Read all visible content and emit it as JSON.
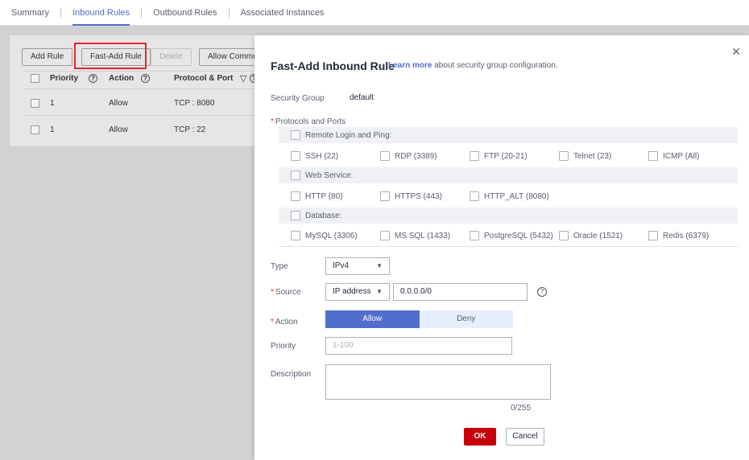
{
  "tabs": [
    {
      "label": "Summary"
    },
    {
      "label": "Inbound Rules"
    },
    {
      "label": "Outbound Rules"
    },
    {
      "label": "Associated Instances"
    }
  ],
  "background": {
    "buttons": {
      "add_rule": "Add Rule",
      "fast_add_rule": "Fast-Add Rule",
      "delete": "Delete",
      "allow_common": "Allow Commor"
    },
    "table_headers": {
      "priority": "Priority",
      "action": "Action",
      "protocol_port": "Protocol & Port"
    },
    "rows": [
      {
        "priority": "1",
        "action": "Allow",
        "protocol_port": "TCP : 8080"
      },
      {
        "priority": "1",
        "action": "Allow",
        "protocol_port": "TCP : 22"
      }
    ]
  },
  "drawer": {
    "title": "Fast-Add Inbound Rule",
    "learn_link": "Learn more",
    "learn_suffix": "about security group configuration.",
    "security_group_label": "Security Group",
    "security_group_value": "default",
    "protocols_label": "Protocols and Ports",
    "groups": [
      {
        "name": "Remote Login and Ping:",
        "options": [
          "SSH (22)",
          "RDP (3389)",
          "FTP (20-21)",
          "Telnet (23)",
          "ICMP (All)"
        ]
      },
      {
        "name": "Web Service:",
        "options": [
          "HTTP (80)",
          "HTTPS (443)",
          "HTTP_ALT (8080)"
        ]
      },
      {
        "name": "Database:",
        "options": [
          "MySQL (3306)",
          "MS SQL (1433)",
          "PostgreSQL (5432)",
          "Oracle (1521)",
          "Redis (6379)"
        ]
      }
    ],
    "type_label": "Type",
    "type_value": "IPv4",
    "source_label": "Source",
    "source_type": "IP address",
    "source_value": "0.0.0.0/0",
    "action_label": "Action",
    "action_allow": "Allow",
    "action_deny": "Deny",
    "priority_label": "Priority",
    "priority_placeholder": "1-100",
    "description_label": "Description",
    "description_counter": "0/255",
    "ok": "OK",
    "cancel": "Cancel"
  },
  "colors": {
    "accent": "#526ecc",
    "danger": "#c7000b",
    "highlight": "#e4262a"
  }
}
